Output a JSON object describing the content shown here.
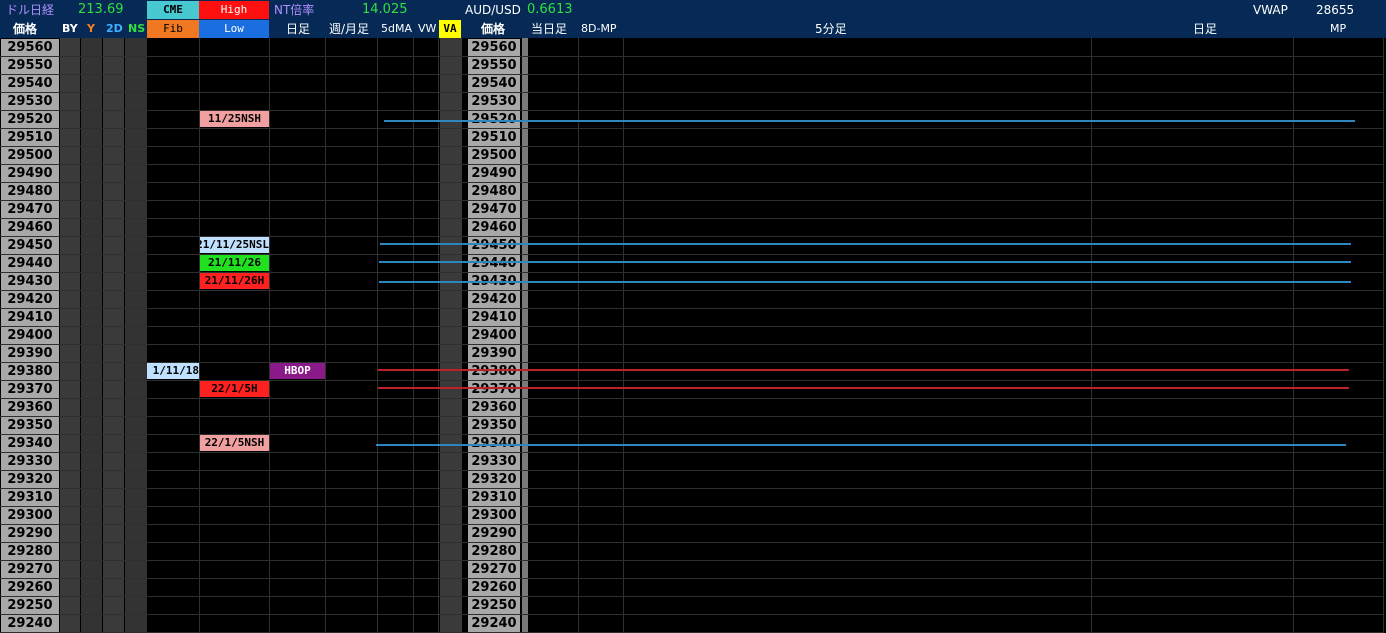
{
  "header": {
    "dollar_nikkei_label": "ドル日経",
    "dollar_nikkei_value": "213.69",
    "cme": "CME",
    "high": "High",
    "nt_label": "NT倍率",
    "nt_value": "14.025",
    "aud_label": "AUD/USD",
    "aud_value": "0.6613",
    "vwap_label": "VWAP",
    "vwap_value": "28655"
  },
  "subheader": {
    "price": "価格",
    "by": "BY",
    "y": "Y",
    "d2": "2D",
    "ns": "NS",
    "fib": "Fib",
    "low": "Low",
    "daily": "日足",
    "weekly_monthly": "週/月足",
    "ma5d": "5dMA",
    "vw": "VW",
    "va": "VA",
    "price_right": "価格",
    "today": "当日足",
    "mp8d": "8D-MP",
    "min5": "5分足",
    "daily_right": "日足",
    "mp": "MP"
  },
  "prices": [
    "29560",
    "29550",
    "29540",
    "29530",
    "29520",
    "29510",
    "29500",
    "29490",
    "29480",
    "29470",
    "29460",
    "29450",
    "29440",
    "29430",
    "29420",
    "29410",
    "29400",
    "29390",
    "29380",
    "29370",
    "29360",
    "29350",
    "29340",
    "29330",
    "29320",
    "29310",
    "29300",
    "29290",
    "29280",
    "29270",
    "29260",
    "29250",
    "29240"
  ],
  "tags": {
    "t29520": "11/25NSH",
    "t29450": "21/11/25NSL",
    "t29440": "21/11/26",
    "t29430": "21/11/26H",
    "t29380_fib": "1/11/18",
    "t29380_daily": "HBOP",
    "t29370": "22/1/5H",
    "t29340": "22/1/5NSH"
  },
  "colors": {
    "header_bg": "#062a55",
    "price_cell": "#a8a8a8",
    "line_blue": "#2e86c1",
    "line_red": "#c0202a",
    "cme_bg": "#48c8d0",
    "high_bg": "#ff1010",
    "fib_bg": "#f07820",
    "low_bg": "#1a6ee0",
    "va_bg": "#ffff00"
  }
}
